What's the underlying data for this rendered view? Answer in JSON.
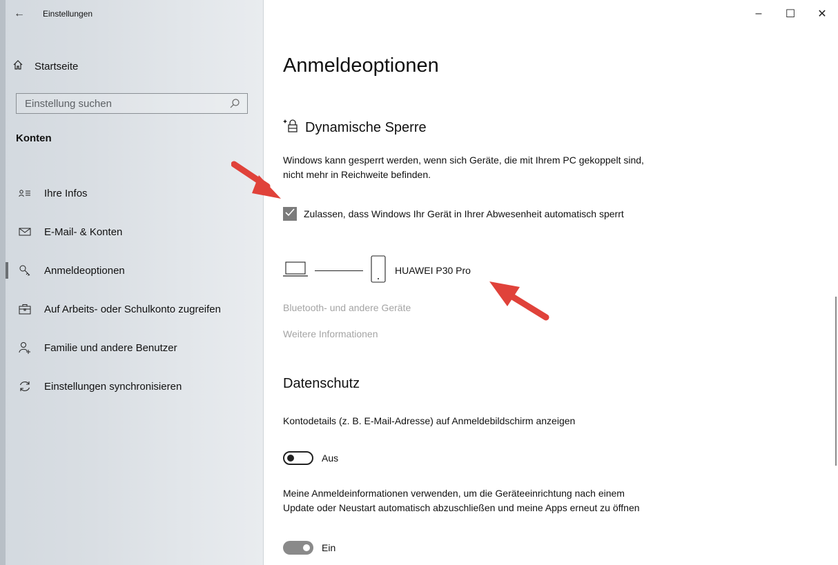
{
  "window": {
    "app_title": "Einstellungen",
    "back_icon": "back-arrow-icon",
    "minimize_label": "–",
    "maximize_label": "☐",
    "close_label": "✕"
  },
  "sidebar": {
    "home": {
      "label": "Startseite",
      "icon": "home-icon"
    },
    "search": {
      "placeholder": "Einstellung suchen",
      "value": ""
    },
    "section_header": "Konten",
    "items": [
      {
        "label": "Ihre Infos",
        "icon": "person-card-icon",
        "active": false
      },
      {
        "label": "E-Mail- & Konten",
        "icon": "mail-icon",
        "active": false
      },
      {
        "label": "Anmeldeoptionen",
        "icon": "key-icon",
        "active": true
      },
      {
        "label": "Auf Arbeits- oder Schulkonto zugreifen",
        "icon": "briefcase-icon",
        "active": false
      },
      {
        "label": "Familie und andere Benutzer",
        "icon": "add-person-icon",
        "active": false
      },
      {
        "label": "Einstellungen synchronisieren",
        "icon": "sync-icon",
        "active": false
      }
    ]
  },
  "main": {
    "page_title": "Anmeldeoptionen",
    "dynamic_lock": {
      "title": "Dynamische Sperre",
      "icon": "dynamic-lock-icon",
      "description": "Windows kann gesperrt werden, wenn sich Geräte, die mit Ihrem PC gekoppelt sind, nicht mehr in Reichweite befinden.",
      "checkbox_label": "Zulassen, dass Windows Ihr Gerät in Ihrer Abwesenheit automatisch sperrt",
      "checkbox_checked": true,
      "device_name": "HUAWEI P30 Pro",
      "link_bluetooth": "Bluetooth- und andere Geräte",
      "link_more_info": "Weitere Informationen"
    },
    "privacy": {
      "title": "Datenschutz",
      "setting1_text": "Kontodetails (z. B. E-Mail-Adresse) auf Anmeldebildschirm anzeigen",
      "setting1_state": "Aus",
      "setting1_on": false,
      "setting2_text": "Meine Anmeldeinformationen verwenden, um die Geräteeinrichtung nach einem Update oder Neustart automatisch abzuschließen und meine Apps erneut zu öffnen",
      "setting2_state": "Ein",
      "setting2_on": true
    }
  },
  "colors": {
    "arrow": "#e0423a",
    "toggle_on": "#8a8a8a",
    "checkbox": "#7b7b7b",
    "link": "#a4a4a4"
  }
}
